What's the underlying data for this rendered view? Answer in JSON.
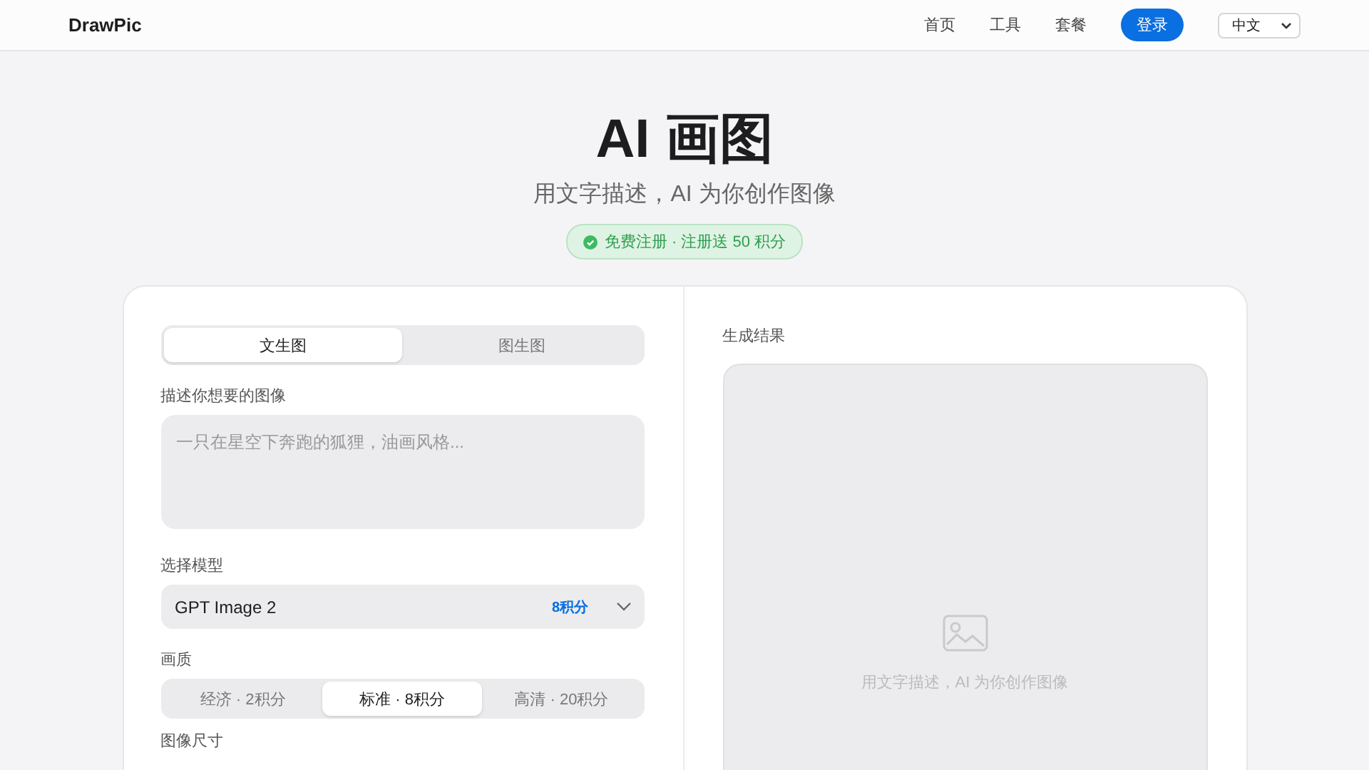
{
  "header": {
    "logo": "DrawPic",
    "nav": [
      {
        "label": "首页"
      },
      {
        "label": "工具"
      },
      {
        "label": "套餐"
      }
    ],
    "login": "登录",
    "language": "中文"
  },
  "hero": {
    "title": "AI 画图",
    "subtitle": "用文字描述，AI 为你创作图像",
    "badge": "免费注册 · 注册送 50 积分"
  },
  "form": {
    "mode_tabs": [
      {
        "label": "文生图",
        "selected": true
      },
      {
        "label": "图生图",
        "selected": false
      }
    ],
    "prompt_label": "描述你想要的图像",
    "prompt": {
      "placeholder": "一只在星空下奔跑的狐狸，油画风格..."
    },
    "model_label": "选择模型",
    "model": {
      "value": "GPT Image 2",
      "cost": "8积分"
    },
    "quality_label": "画质",
    "quality": [
      {
        "label": "经济 · 2积分",
        "selected": false
      },
      {
        "label": "标准 · 8积分",
        "selected": true
      },
      {
        "label": "高清 · 20积分",
        "selected": false
      }
    ],
    "size_label": "图像尺寸"
  },
  "result": {
    "label": "生成结果",
    "empty_text": "用文字描述，AI 为你创作图像"
  }
}
